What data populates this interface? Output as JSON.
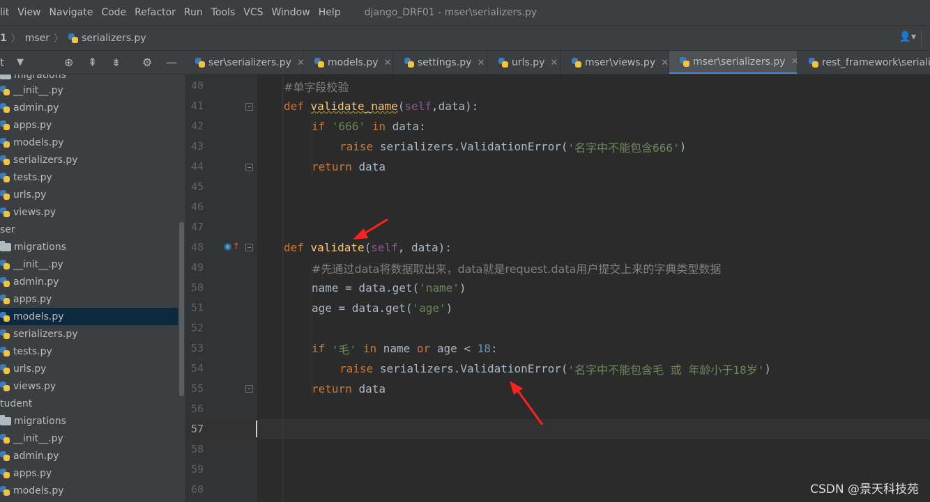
{
  "menubar": {
    "items": [
      "lit",
      "View",
      "Navigate",
      "Code",
      "Refactor",
      "Run",
      "Tools",
      "VCS",
      "Window",
      "Help"
    ],
    "window_title": "django_DRF01 - mser\\serializers.py"
  },
  "navbar": {
    "crumbs": [
      "1",
      "mser",
      "serializers.py"
    ],
    "user_icon": "user-icon"
  },
  "sidebar": {
    "header_label": "t",
    "toolbar_icons": [
      "dropdown-icon",
      "locate-icon",
      "expand-icon",
      "collapse-icon",
      "gear-icon",
      "minimize-icon"
    ],
    "items": [
      {
        "label": "migrations",
        "icon": "folder-icon",
        "partial": true
      },
      {
        "label": "__init__.py",
        "icon": "python-file-icon"
      },
      {
        "label": "admin.py",
        "icon": "python-file-icon"
      },
      {
        "label": "apps.py",
        "icon": "python-file-icon"
      },
      {
        "label": "models.py",
        "icon": "python-file-icon"
      },
      {
        "label": "serializers.py",
        "icon": "python-file-icon"
      },
      {
        "label": "tests.py",
        "icon": "python-file-icon"
      },
      {
        "label": "urls.py",
        "icon": "python-file-icon"
      },
      {
        "label": "views.py",
        "icon": "python-file-icon"
      },
      {
        "label": "ser",
        "icon": "none"
      },
      {
        "label": "migrations",
        "icon": "folder-icon"
      },
      {
        "label": "__init__.py",
        "icon": "python-file-icon"
      },
      {
        "label": "admin.py",
        "icon": "python-file-icon"
      },
      {
        "label": "apps.py",
        "icon": "python-file-icon"
      },
      {
        "label": "models.py",
        "icon": "python-file-icon",
        "selected": true
      },
      {
        "label": "serializers.py",
        "icon": "python-file-icon"
      },
      {
        "label": "tests.py",
        "icon": "python-file-icon"
      },
      {
        "label": "urls.py",
        "icon": "python-file-icon"
      },
      {
        "label": "views.py",
        "icon": "python-file-icon"
      },
      {
        "label": "tudent",
        "icon": "none"
      },
      {
        "label": "migrations",
        "icon": "folder-icon"
      },
      {
        "label": "__init__.py",
        "icon": "python-file-icon"
      },
      {
        "label": "admin.py",
        "icon": "python-file-icon"
      },
      {
        "label": "apps.py",
        "icon": "python-file-icon"
      },
      {
        "label": "models.py",
        "icon": "python-file-icon"
      }
    ]
  },
  "tabs": [
    {
      "label": "ser\\serializers.py",
      "active": false
    },
    {
      "label": "models.py",
      "active": false
    },
    {
      "label": "settings.py",
      "active": false
    },
    {
      "label": "urls.py",
      "active": false
    },
    {
      "label": "mser\\views.py",
      "active": false
    },
    {
      "label": "mser\\serializers.py",
      "active": true
    },
    {
      "label": "rest_framework\\serializers.py",
      "active": false
    }
  ],
  "editor": {
    "line_numbers": [
      "40",
      "41",
      "42",
      "43",
      "44",
      "45",
      "46",
      "47",
      "48",
      "49",
      "50",
      "51",
      "52",
      "53",
      "54",
      "55",
      "56",
      "57",
      "58",
      "59",
      "60"
    ],
    "current_line": "57",
    "code": {
      "l40": "#单字段校验",
      "l41_def": "def",
      "l41_name": "validate_name",
      "l41_open": "(",
      "l41_self": "self",
      "l41_rest": ",data):",
      "l42_if": "if",
      "l42_str": "'666'",
      "l42_in": "in",
      "l42_rest": "data:",
      "l43_raise": "raise",
      "l43_call": "serializers.ValidationError(",
      "l43_str": "'名字中不能包含666'",
      "l43_close": ")",
      "l44_return": "return",
      "l44_rest": "data",
      "l48_def": "def",
      "l48_name": "validate",
      "l48_open": "(",
      "l48_self": "self",
      "l48_rest": ", data):",
      "l49": "#先通过data将数据取出来，data就是request.data用户提交上来的字典类型数据",
      "l50_a": "name = data.get(",
      "l50_str": "'name'",
      "l50_b": ")",
      "l51_a": "age = data.get(",
      "l51_str": "'age'",
      "l51_b": ")",
      "l53_if": "if",
      "l53_str": "'毛'",
      "l53_in": "in",
      "l53_name": "name",
      "l53_or": "or",
      "l53_cmp": "age <",
      "l53_num": "18",
      "l53_colon": ":",
      "l54_raise": "raise",
      "l54_call": "serializers.ValidationError(",
      "l54_str": "'名字中不能包含毛 或 年龄小于18岁'",
      "l54_close": ")",
      "l55_return": "return",
      "l55_rest": "data"
    }
  },
  "watermark": "CSDN @景天科技苑",
  "colors": {
    "keyword": "#cc7832",
    "function": "#ffc66d",
    "string": "#6a8759",
    "number": "#6897bb",
    "comment": "#808080",
    "self": "#94558d",
    "annotation_arrow": "#ff2020"
  }
}
